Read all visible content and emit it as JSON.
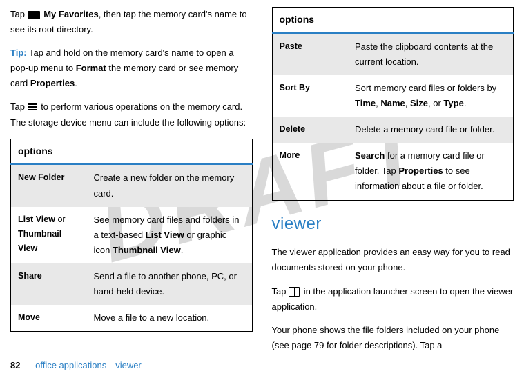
{
  "watermark": "DRAFT",
  "left": {
    "para1_pre": "Tap ",
    "para1_bold": "My Favorites",
    "para1_post": ", then tap the memory card's name to see its root directory.",
    "tip_label": "Tip:",
    "tip_pre": " Tap and hold on the memory card's name to open a pop-up menu to ",
    "tip_bold1": "Format",
    "tip_mid": " the memory card or see memory card ",
    "tip_bold2": "Properties",
    "tip_end": ".",
    "para3_pre": "Tap ",
    "para3_post": " to perform various operations on the memory card. The storage device menu can include the following options:",
    "table": {
      "header": "options",
      "rows": [
        {
          "label": "New Folder",
          "desc": "Create a new folder on the memory card."
        },
        {
          "label_a": "List View",
          "label_mid": " or ",
          "label_b": "Thumbnail View",
          "desc_pre": "See memory card files and folders in a text-based ",
          "desc_bold1": "List View",
          "desc_mid": " or graphic icon ",
          "desc_bold2": "Thumbnail View",
          "desc_end": "."
        },
        {
          "label": "Share",
          "desc": "Send a file to another phone, PC, or hand-held device."
        },
        {
          "label": "Move",
          "desc": "Move a file to a new location."
        }
      ]
    }
  },
  "right": {
    "table": {
      "header": "options",
      "rows": [
        {
          "label": "Paste",
          "desc": "Paste the clipboard contents at the current location."
        },
        {
          "label": "Sort By",
          "desc_pre": "Sort memory card files or folders by ",
          "b1": "Time",
          "c1": ", ",
          "b2": "Name",
          "c2": ", ",
          "b3": "Size",
          "c3": ", or ",
          "b4": "Type",
          "c4": "."
        },
        {
          "label": "Delete",
          "desc": "Delete a memory card file or folder."
        },
        {
          "label": "More",
          "d_b1": "Search",
          "d_mid1": " for a memory card file or folder. Tap ",
          "d_b2": "Properties",
          "d_mid2": " to see information about a file or folder."
        }
      ]
    },
    "heading": "viewer",
    "para1": "The viewer application provides an easy way for you to read documents stored on your phone.",
    "para2_pre": "Tap ",
    "para2_post": " in the application launcher screen to open the viewer application.",
    "para3": "Your phone shows the file folders included on your phone (see page 79 for folder descriptions). Tap a"
  },
  "footer": {
    "page": "82",
    "section": "office applications—viewer"
  }
}
